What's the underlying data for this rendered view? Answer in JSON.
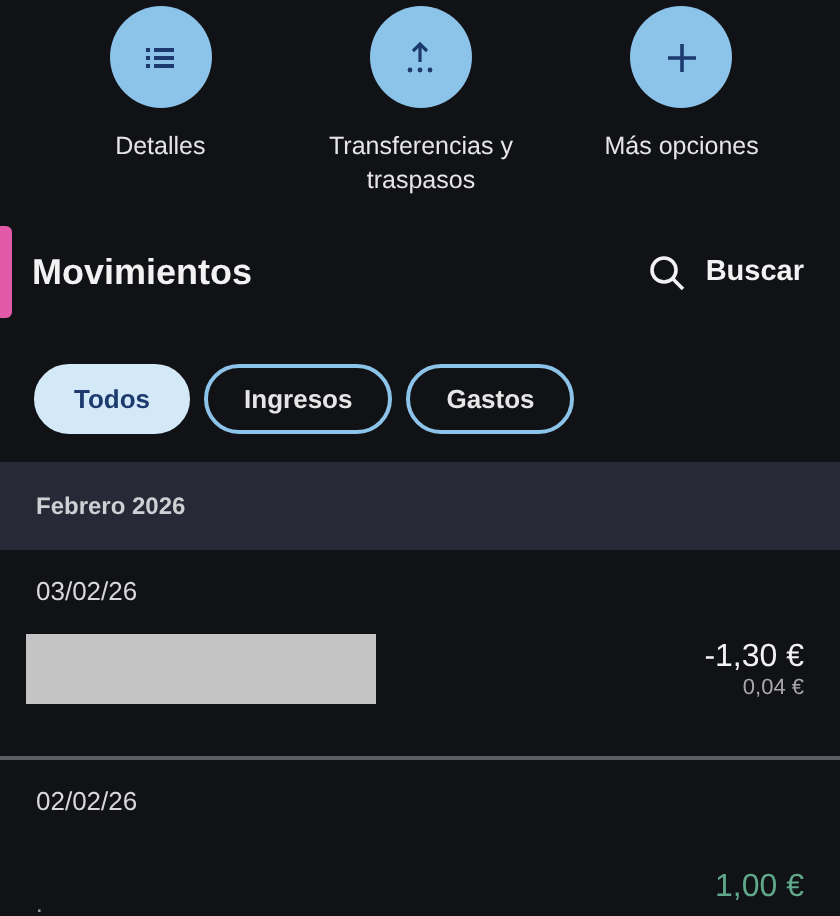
{
  "actions": [
    {
      "kind": "list",
      "label": "Detalles"
    },
    {
      "kind": "transfer",
      "label": "Transferencias y traspasos"
    },
    {
      "kind": "plus",
      "label": "Más opciones"
    }
  ],
  "section": {
    "title": "Movimientos",
    "search": "Buscar"
  },
  "filters": [
    {
      "label": "Todos",
      "selected": true
    },
    {
      "label": "Ingresos",
      "selected": false
    },
    {
      "label": "Gastos",
      "selected": false
    }
  ],
  "month": "Febrero 2026",
  "transactions": [
    {
      "date": "03/02/26",
      "description_redacted": true,
      "amount": "-1,30 €",
      "kind": "expense",
      "secondary": "0,04 €"
    },
    {
      "date": "02/02/26",
      "description": ".",
      "amount": "1,00 €",
      "kind": "income"
    }
  ]
}
